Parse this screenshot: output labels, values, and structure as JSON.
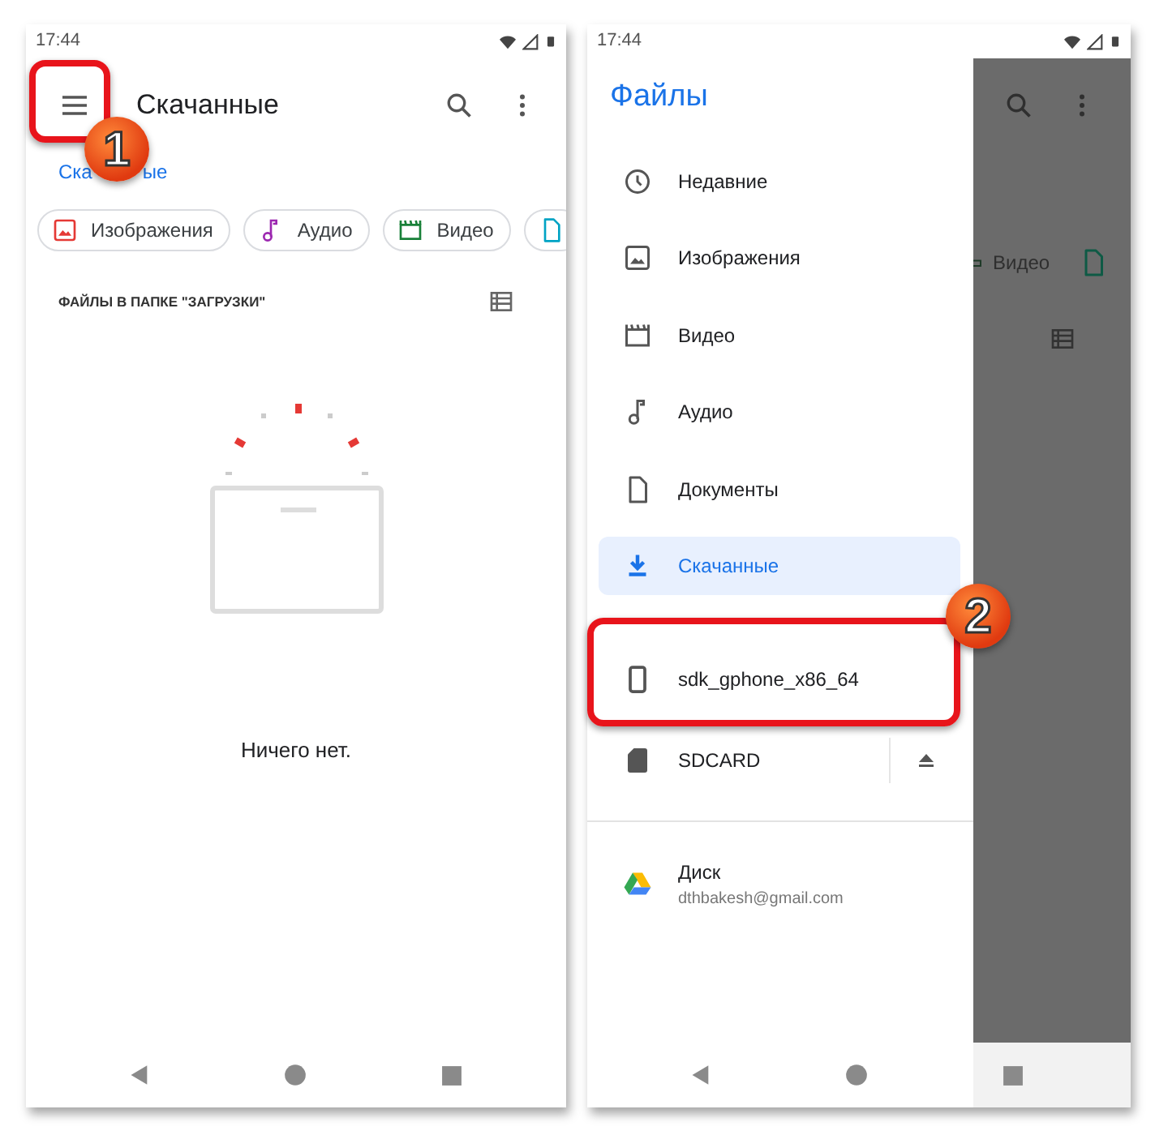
{
  "screens": [
    {
      "status_bar": {
        "time": "17:44"
      },
      "app_bar": {
        "title": "Скачанные"
      },
      "breadcrumb": [
        "Ска",
        "ые"
      ],
      "chips": [
        {
          "kind": "images",
          "label": "Изображения"
        },
        {
          "kind": "audio",
          "label": "Аудио"
        },
        {
          "kind": "video",
          "label": "Видео"
        },
        {
          "kind": "documents"
        }
      ],
      "section_header": "ФАЙЛЫ В ПАПКЕ \"ЗАГРУЗКИ\"",
      "empty_message": "Ничего нет."
    },
    {
      "status_bar": {
        "time": "17:44"
      },
      "drawer": {
        "title": "Файлы",
        "items": [
          {
            "kind": "recent",
            "label": "Недавние",
            "selected": false
          },
          {
            "kind": "images",
            "label": "Изображения",
            "selected": false
          },
          {
            "kind": "video",
            "label": "Видео",
            "selected": false
          },
          {
            "kind": "audio",
            "label": "Аудио",
            "selected": false
          },
          {
            "kind": "documents",
            "label": "Документы",
            "selected": false
          },
          {
            "kind": "downloads",
            "label": "Скачанные",
            "selected": true
          }
        ],
        "storage": [
          {
            "kind": "phone",
            "label": "sdk_gphone_x86_64",
            "selected": false,
            "ejectable": false
          },
          {
            "kind": "sdcard",
            "label": "SDCARD",
            "selected": false,
            "ejectable": true
          }
        ],
        "accounts": [
          {
            "kind": "drive",
            "label": "Диск",
            "subtitle": "dthbakesh@gmail.com"
          }
        ]
      },
      "behind_drawer": {
        "chip_label": "Видео"
      }
    }
  ],
  "annotations": [
    {
      "number": "1"
    },
    {
      "number": "2"
    }
  ]
}
